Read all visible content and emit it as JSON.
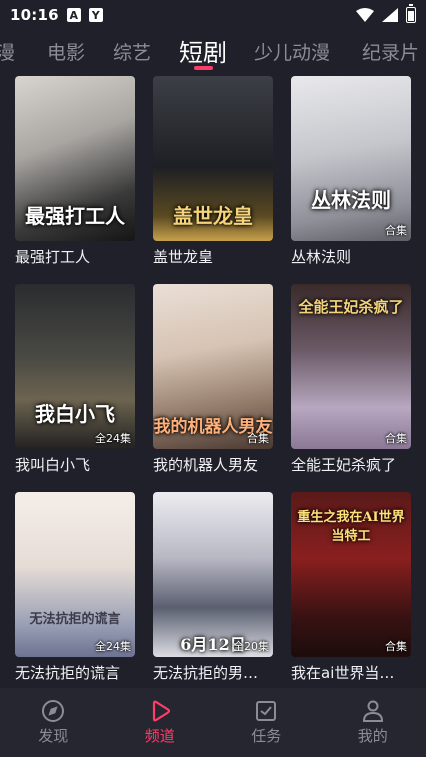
{
  "status": {
    "time": "10:16",
    "app1": "A",
    "app2": "Y"
  },
  "tabs": [
    "漫",
    "电影",
    "综艺",
    "短剧",
    "少儿动漫",
    "纪录片"
  ],
  "active_tab": "短剧",
  "cards": [
    {
      "title": "最强打工人",
      "poster_text": "最强打工人",
      "badge": ""
    },
    {
      "title": "盖世龙皇",
      "poster_text": "盖世龙皇",
      "badge": ""
    },
    {
      "title": "丛林法则",
      "poster_text": "丛林法则",
      "badge": "合集"
    },
    {
      "title": "我叫白小飞",
      "poster_text": "我白小飞",
      "badge": "全24集"
    },
    {
      "title": "我的机器人男友",
      "poster_text": "我的机器人男友",
      "badge": "合集"
    },
    {
      "title": "全能王妃杀疯了",
      "poster_text": "全能王妃杀疯了",
      "badge": "合集"
    },
    {
      "title": "无法抗拒的谎言",
      "poster_text": "无法抗拒的谎言",
      "badge": "全24集"
    },
    {
      "title": "无法抗拒的男…",
      "poster_text": "6月12日",
      "badge": "全20集"
    },
    {
      "title": "我在ai世界当…",
      "poster_text": "重生之我在AI世界当特工",
      "badge": "合集"
    }
  ],
  "nav": [
    {
      "label": "发现",
      "icon": "compass-icon"
    },
    {
      "label": "频道",
      "icon": "play-icon"
    },
    {
      "label": "任务",
      "icon": "task-icon"
    },
    {
      "label": "我的",
      "icon": "user-icon"
    }
  ],
  "colors": {
    "accent": "#ff3d6a",
    "background": "#1f2029",
    "navbar": "#25262f"
  }
}
